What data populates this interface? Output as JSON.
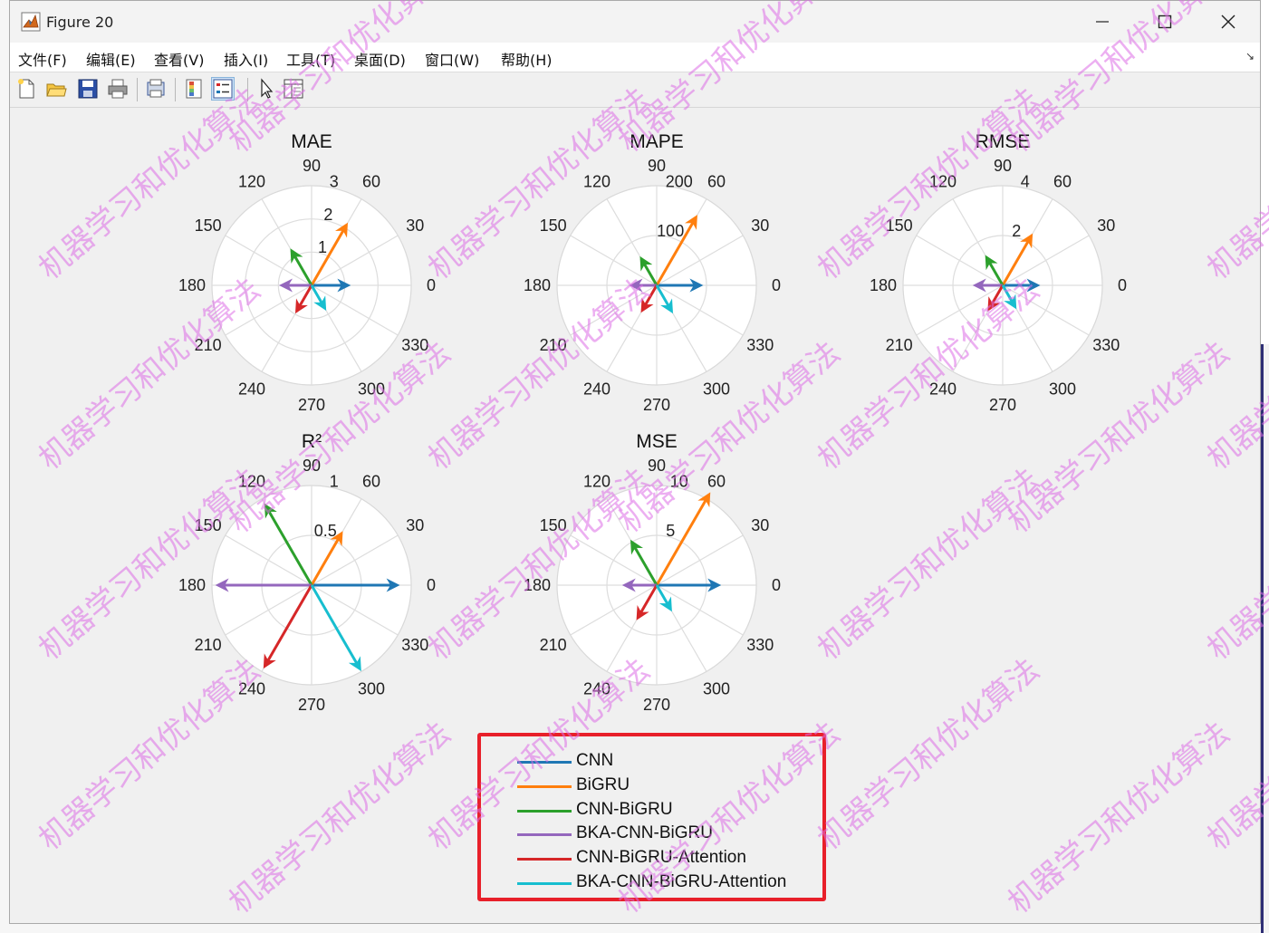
{
  "window": {
    "title": "Figure 20",
    "minimize_icon": "minimize-icon",
    "maximize_icon": "maximize-icon",
    "close_icon": "close-icon"
  },
  "menu": {
    "items": [
      "文件(F)",
      "编辑(E)",
      "查看(V)",
      "插入(I)",
      "工具(T)",
      "桌面(D)",
      "窗口(W)",
      "帮助(H)"
    ]
  },
  "toolbar": {
    "icons": [
      "new-figure-icon",
      "open-file-icon",
      "save-icon",
      "print-icon",
      "print-preview-icon",
      "colorbar-icon",
      "legend-icon",
      "pointer-icon",
      "property-editor-icon"
    ]
  },
  "watermark": "机器学习和优化算法",
  "colors": {
    "CNN": "#1f77b4",
    "BiGRU": "#ff7f0e",
    "CNN-BiGRU": "#2ca02c",
    "BKA-CNN-BiGRU": "#9467bd",
    "CNN-BiGRU-Attention": "#d62728",
    "BKA-CNN-BiGRU-Attention": "#17becf",
    "legend_border": "#e8202a"
  },
  "chart_data": [
    {
      "type": "polar-compass",
      "title": "MAE",
      "rmax": 3,
      "rticks": [
        "1",
        "2",
        "3"
      ],
      "theta_ticks": [
        "0",
        "30",
        "60",
        "90",
        "120",
        "150",
        "180",
        "210",
        "240",
        "270",
        "300",
        "330"
      ],
      "series": [
        {
          "name": "CNN",
          "angle_deg": 0,
          "r": 1.1
        },
        {
          "name": "BiGRU",
          "angle_deg": 60,
          "r": 2.1
        },
        {
          "name": "CNN-BiGRU",
          "angle_deg": 120,
          "r": 1.2
        },
        {
          "name": "BKA-CNN-BiGRU",
          "angle_deg": 180,
          "r": 0.9
        },
        {
          "name": "CNN-BiGRU-Attention",
          "angle_deg": 240,
          "r": 0.9
        },
        {
          "name": "BKA-CNN-BiGRU-Attention",
          "angle_deg": 300,
          "r": 0.8
        }
      ]
    },
    {
      "type": "polar-compass",
      "title": "MAPE",
      "rmax": 200,
      "rticks": [
        "100",
        "200"
      ],
      "theta_ticks": [
        "0",
        "30",
        "60",
        "90",
        "120",
        "150",
        "180",
        "210",
        "240",
        "270",
        "300",
        "330"
      ],
      "series": [
        {
          "name": "CNN",
          "angle_deg": 0,
          "r": 88
        },
        {
          "name": "BiGRU",
          "angle_deg": 60,
          "r": 158
        },
        {
          "name": "CNN-BiGRU",
          "angle_deg": 120,
          "r": 62
        },
        {
          "name": "BKA-CNN-BiGRU",
          "angle_deg": 180,
          "r": 50
        },
        {
          "name": "CNN-BiGRU-Attention",
          "angle_deg": 240,
          "r": 58
        },
        {
          "name": "BKA-CNN-BiGRU-Attention",
          "angle_deg": 300,
          "r": 60
        }
      ]
    },
    {
      "type": "polar-compass",
      "title": "RMSE",
      "rmax": 4,
      "rticks": [
        "2",
        "4"
      ],
      "theta_ticks": [
        "0",
        "30",
        "60",
        "90",
        "120",
        "150",
        "180",
        "210",
        "240",
        "270",
        "300",
        "330"
      ],
      "series": [
        {
          "name": "CNN",
          "angle_deg": 0,
          "r": 1.4
        },
        {
          "name": "BiGRU",
          "angle_deg": 60,
          "r": 2.3
        },
        {
          "name": "CNN-BiGRU",
          "angle_deg": 120,
          "r": 1.3
        },
        {
          "name": "BKA-CNN-BiGRU",
          "angle_deg": 180,
          "r": 1.1
        },
        {
          "name": "CNN-BiGRU-Attention",
          "angle_deg": 240,
          "r": 1.1
        },
        {
          "name": "BKA-CNN-BiGRU-Attention",
          "angle_deg": 300,
          "r": 1.0
        }
      ]
    },
    {
      "type": "polar-compass",
      "title": "R²",
      "rmax": 1,
      "rticks": [
        "0.5",
        "1"
      ],
      "theta_ticks": [
        "0",
        "30",
        "60",
        "90",
        "120",
        "150",
        "180",
        "210",
        "240",
        "270",
        "300",
        "330"
      ],
      "series": [
        {
          "name": "CNN",
          "angle_deg": 0,
          "r": 0.86
        },
        {
          "name": "BiGRU",
          "angle_deg": 60,
          "r": 0.6
        },
        {
          "name": "CNN-BiGRU",
          "angle_deg": 120,
          "r": 0.92
        },
        {
          "name": "BKA-CNN-BiGRU",
          "angle_deg": 180,
          "r": 0.94
        },
        {
          "name": "CNN-BiGRU-Attention",
          "angle_deg": 240,
          "r": 0.94
        },
        {
          "name": "BKA-CNN-BiGRU-Attention",
          "angle_deg": 300,
          "r": 0.97
        }
      ]
    },
    {
      "type": "polar-compass",
      "title": "MSE",
      "rmax": 10,
      "rticks": [
        "5",
        "10"
      ],
      "theta_ticks": [
        "0",
        "30",
        "60",
        "90",
        "120",
        "150",
        "180",
        "210",
        "240",
        "270",
        "300",
        "330"
      ],
      "series": [
        {
          "name": "CNN",
          "angle_deg": 0,
          "r": 6.2
        },
        {
          "name": "BiGRU",
          "angle_deg": 60,
          "r": 10.5
        },
        {
          "name": "CNN-BiGRU",
          "angle_deg": 120,
          "r": 5.0
        },
        {
          "name": "BKA-CNN-BiGRU",
          "angle_deg": 180,
          "r": 3.2
        },
        {
          "name": "CNN-BiGRU-Attention",
          "angle_deg": 240,
          "r": 3.8
        },
        {
          "name": "BKA-CNN-BiGRU-Attention",
          "angle_deg": 300,
          "r": 2.8
        }
      ]
    }
  ],
  "legend": {
    "placement": "bottom-center",
    "entries": [
      "CNN",
      "BiGRU",
      "CNN-BiGRU",
      "BKA-CNN-BiGRU",
      "CNN-BiGRU-Attention",
      "BKA-CNN-BiGRU-Attention"
    ]
  }
}
